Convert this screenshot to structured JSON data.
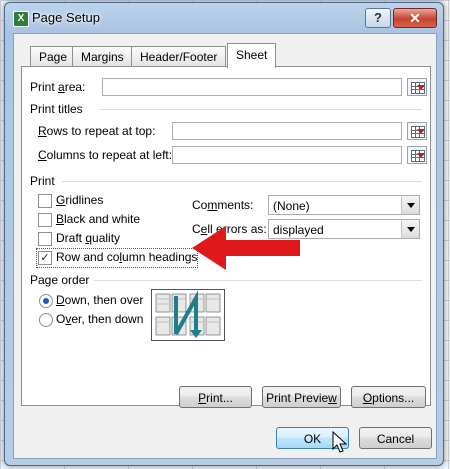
{
  "window": {
    "title": "Page Setup",
    "help_label": "?",
    "close_label": "✕",
    "app_icon_label": "X"
  },
  "tabs": [
    {
      "label": "Page",
      "active": false
    },
    {
      "label": "Margins",
      "active": false
    },
    {
      "label": "Header/Footer",
      "active": false
    },
    {
      "label": "Sheet",
      "active": true
    }
  ],
  "print_area": {
    "label_pre": "Print ",
    "label_key": "a",
    "label_post": "rea:",
    "value": ""
  },
  "print_titles": {
    "heading": "Print titles",
    "rows": {
      "label_pre": "",
      "label_key": "R",
      "label_post": "ows to repeat at top:",
      "value": ""
    },
    "columns": {
      "label_pre": "",
      "label_key": "C",
      "label_post": "olumns to repeat at left:",
      "value": ""
    }
  },
  "print": {
    "heading": "Print",
    "gridlines": {
      "label_pre": "",
      "label_key": "G",
      "label_post": "ridlines",
      "checked": false
    },
    "black_white": {
      "label_pre": "",
      "label_key": "B",
      "label_post": "lack and white",
      "checked": false
    },
    "draft_quality": {
      "label_pre": "Draft ",
      "label_key": "q",
      "label_post": "uality",
      "checked": false
    },
    "row_col_headings": {
      "label_pre": "Row and co",
      "label_key": "l",
      "label_post": "umn headings",
      "checked": true,
      "check_glyph": "✓"
    },
    "comments": {
      "label_pre": "Co",
      "label_key": "m",
      "label_post": "ments:",
      "value": "(None)"
    },
    "cell_errors": {
      "label_pre": "C",
      "label_key": "e",
      "label_post": "ll errors as:",
      "value": "displayed"
    }
  },
  "page_order": {
    "heading": "Page order",
    "down_then_over": {
      "label_pre": "",
      "label_key": "D",
      "label_post": "own, then over",
      "checked": true
    },
    "over_then_down": {
      "label_pre": "O",
      "label_key": "v",
      "label_post": "er, then down",
      "checked": false
    }
  },
  "buttons": {
    "print": {
      "label_pre": "",
      "label_key": "P",
      "label_post": "rint..."
    },
    "print_preview": {
      "label_pre": "Print Previe",
      "label_key": "w",
      "label_post": ""
    },
    "options": {
      "label_pre": "",
      "label_key": "O",
      "label_post": "ptions..."
    },
    "ok": "OK",
    "cancel": "Cancel"
  },
  "colors": {
    "annotation_arrow": "#e0181b",
    "titlebar": "#bcd3ea",
    "close_button": "#c7432e"
  },
  "icons": [
    "collapse-dialog-icon",
    "page-order-icon",
    "red-arrow-annotation",
    "mouse-cursor-icon"
  ]
}
